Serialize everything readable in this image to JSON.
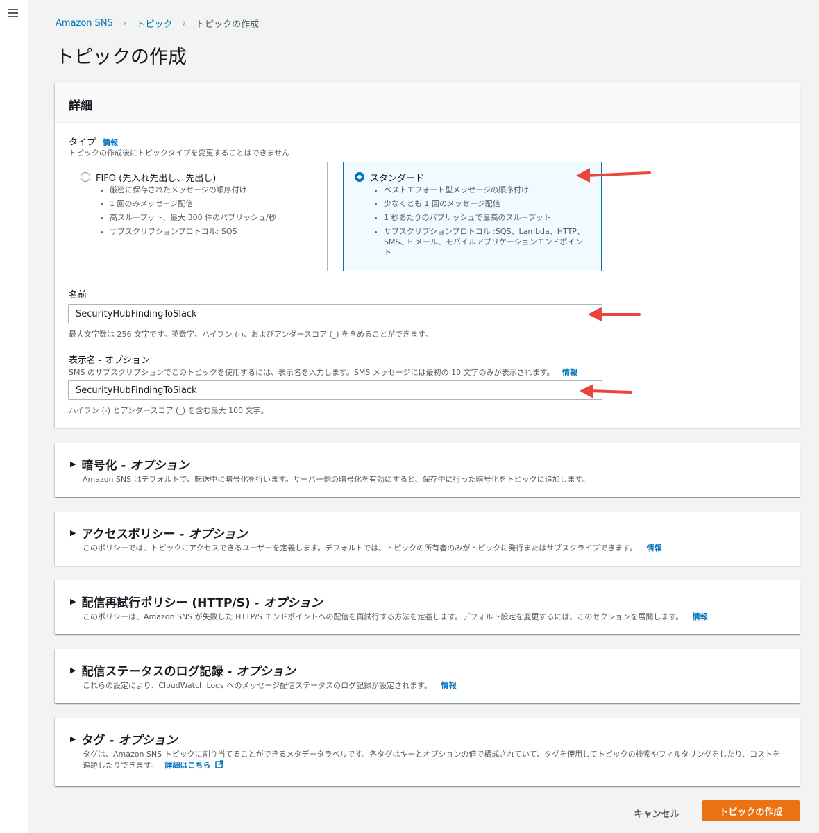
{
  "breadcrumbs": [
    "Amazon SNS",
    "トピック",
    "トピックの作成"
  ],
  "page_title": "トピックの作成",
  "details": {
    "heading": "詳細",
    "type_label": "タイプ",
    "info_label": "情報",
    "type_desc": "トピックの作成後にトピックタイプを変更することはできません",
    "fifo": {
      "title": "FIFO (先入れ先出し、先出し)",
      "bullets": [
        "厳密に保存されたメッセージの順序付け",
        "1 回のみメッセージ配信",
        "高スループット、最大 300 件のパブリッシュ/秒",
        "サブスクリプションプロトコル: SQS"
      ]
    },
    "standard": {
      "title": "スタンダード",
      "bullets": [
        "ベストエフォート型メッセージの順序付け",
        "少なくとも 1 回のメッセージ配信",
        "1 秒あたりのパブリッシュで最高のスループット",
        "サブスクリプションプロトコル :SQS、Lambda、HTTP、SMS、E メール、モバイルアプリケーションエンドポイント"
      ]
    },
    "name_label": "名前",
    "name_value": "SecurityHubFindingToSlack",
    "name_hint": "最大文字数は 256 文字です。英数字、ハイフン (-)、およびアンダースコア (_) を含めることができます。",
    "display_label": "表示名 - オプション",
    "display_desc": "SMS のサブスクリプションでこのトピックを使用するには、表示名を入力します。SMS メッセージには最初の 10 文字のみが表示されます。",
    "display_value": "SecurityHubFindingToSlack",
    "display_hint": "ハイフン (-) とアンダースコア (_) を含む最大 100 文字。"
  },
  "sections": [
    {
      "title": "暗号化",
      "optional": "- オプション",
      "desc": "Amazon SNS はデフォルトで、転送中に暗号化を行います。サーバー側の暗号化を有効にすると、保存中に行った暗号化をトピックに追加します。",
      "link": ""
    },
    {
      "title": "アクセスポリシー",
      "optional": "- オプション",
      "desc": "このポリシーでは、トピックにアクセスできるユーザーを定義します。デフォルトでは、トピックの所有者のみがトピックに発行またはサブスクライブできます。",
      "link": "情報"
    },
    {
      "title": "配信再試行ポリシー (HTTP/S)",
      "optional": "- オプション",
      "desc": "このポリシーは、Amazon SNS が失敗した HTTP/S エンドポイントへの配信を再試行する方法を定義します。デフォルト設定を変更するには、このセクションを展開します。",
      "link": "情報"
    },
    {
      "title": "配信ステータスのログ記録",
      "optional": "- オプション",
      "desc": "これらの設定により、CloudWatch Logs へのメッセージ配信ステータスのログ記録が設定されます。",
      "link": "情報"
    },
    {
      "title": "タグ",
      "optional": "- オプション",
      "desc": "タグは、Amazon SNS トピックに割り当てることができるメタデータラベルです。各タグはキーとオプションの値で構成されていて、タグを使用してトピックの検索やフィルタリングをしたり、コストを追跡したりできます。",
      "link": "詳細はこちら"
    }
  ],
  "footer": {
    "cancel": "キャンセル",
    "create": "トピックの作成"
  }
}
